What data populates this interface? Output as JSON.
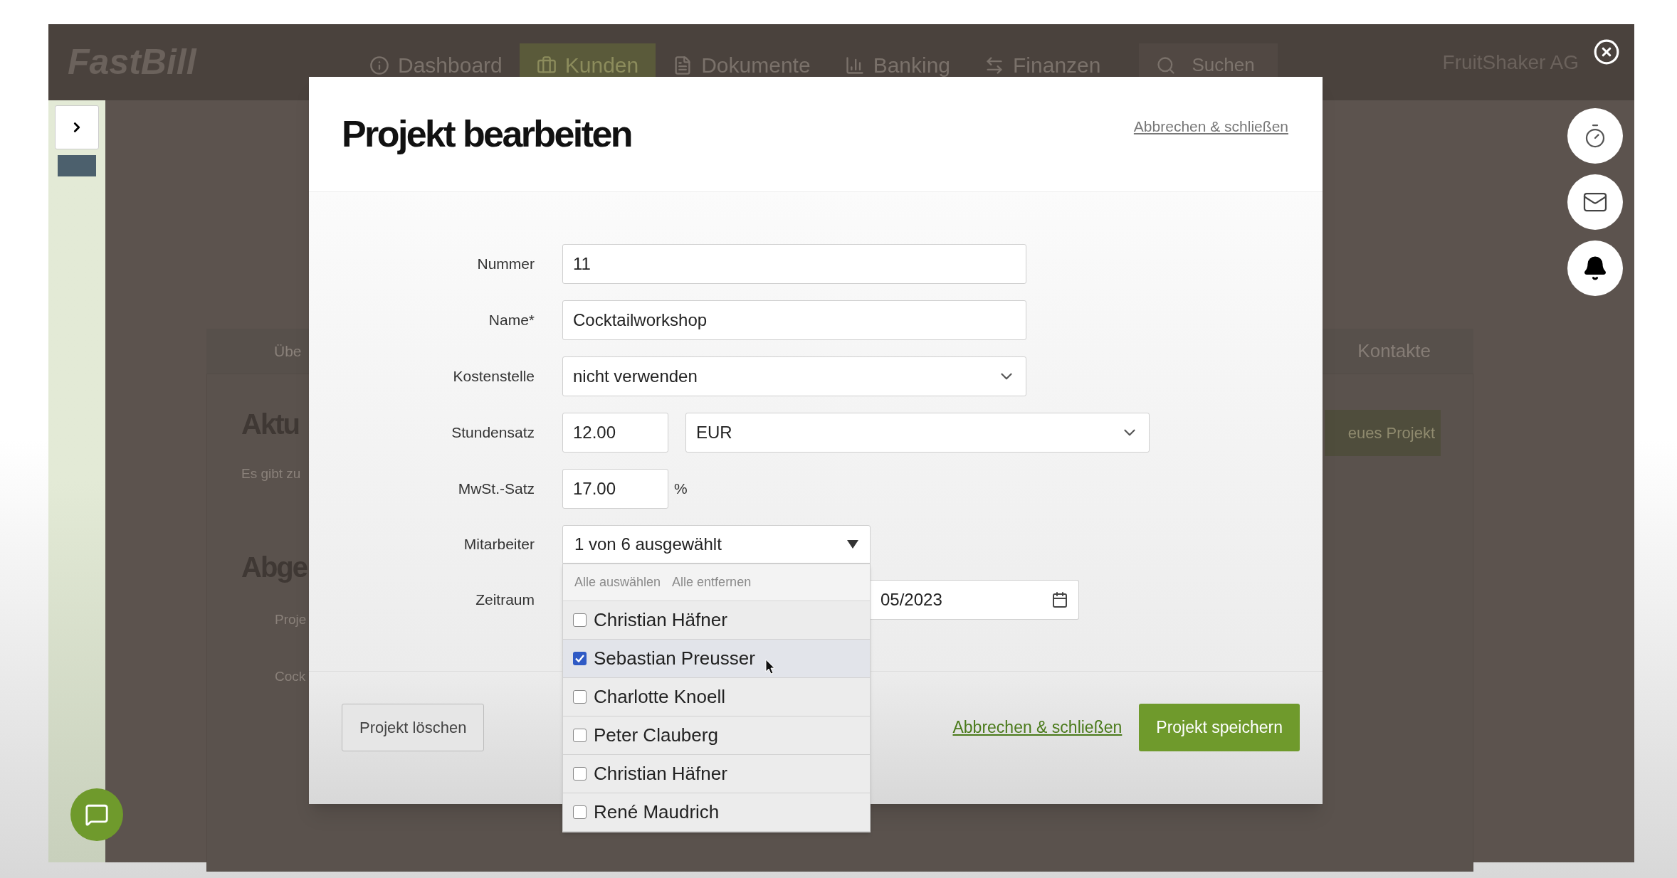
{
  "app_bar": {
    "logo": "FastBill",
    "nav": [
      {
        "label": "Dashboard",
        "selected": false
      },
      {
        "label": "Kunden",
        "selected": true
      },
      {
        "label": "Dokumente",
        "selected": false
      },
      {
        "label": "Banking",
        "selected": false
      },
      {
        "label": "Finanzen",
        "selected": false
      }
    ],
    "search": {
      "placeholder": "Suchen"
    },
    "account": "FruitShaker AG"
  },
  "background_page": {
    "tabs": [
      "Übe",
      "Kontakte"
    ],
    "heading_1": "Aktu",
    "text_1": "Es gibt zu",
    "heading_2": "Abge",
    "column_header": "Proje",
    "row_1": "Cock",
    "new_button": "eues Projekt"
  },
  "dialog": {
    "title": "Projekt bearbeiten",
    "header_link": "Abbrechen & schließen",
    "fields": [
      {
        "kind": "text",
        "label": "Nummer",
        "value": "11"
      },
      {
        "kind": "text",
        "label": "Name*",
        "value": "Cocktailworkshop"
      },
      {
        "kind": "select",
        "label": "Kostenstelle",
        "value": "nicht verwenden"
      },
      {
        "kind": "amount_currency",
        "label": "Stundensatz",
        "value": "12.00",
        "currency": "EUR"
      },
      {
        "kind": "percent",
        "label": "MwSt.-Satz",
        "value": "17.00",
        "unit": "%"
      },
      {
        "kind": "multiselect",
        "label": "Mitarbeiter",
        "value": "1 von 6 ausgewählt",
        "expanded": true,
        "actions": [
          "Alle auswählen",
          "Alle entfernen"
        ],
        "options": [
          {
            "label": "Christian Häfner",
            "checked": false,
            "highlighted": false
          },
          {
            "label": "Sebastian Preusser",
            "checked": true,
            "highlighted": true
          },
          {
            "label": "Charlotte Knoell",
            "checked": false,
            "highlighted": false
          },
          {
            "label": "Peter Clauberg",
            "checked": false,
            "highlighted": false
          },
          {
            "label": "Christian Häfner",
            "checked": false,
            "highlighted": false
          },
          {
            "label": "René Maudrich",
            "checked": false,
            "highlighted": false
          }
        ]
      },
      {
        "kind": "date",
        "label": "Zeitraum",
        "value": "05/2023"
      }
    ],
    "delete_button": "Projekt löschen",
    "cancel_link": "Abbrechen & schließen",
    "save_button": "Projekt speichern"
  }
}
